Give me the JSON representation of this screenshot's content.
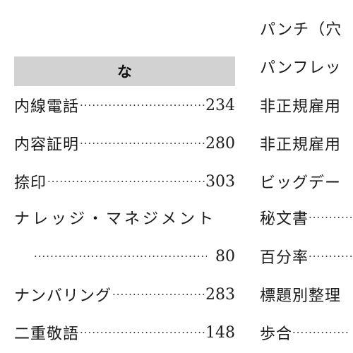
{
  "left_column": {
    "section_header": "な",
    "entries": [
      {
        "term": "内線電話",
        "page": "234"
      },
      {
        "term": "内容証明",
        "page": "280"
      },
      {
        "term": "捺印",
        "page": "303"
      },
      {
        "term": "ナレッジ・マネジメント",
        "page": ""
      },
      {
        "term": "",
        "page": "80"
      },
      {
        "term": "ナンバリング",
        "page": "283"
      },
      {
        "term": "二重敬語",
        "page": "148"
      }
    ]
  },
  "right_column": {
    "entries": [
      {
        "term": "パンチ（穴"
      },
      {
        "term": "パンフレッ"
      },
      {
        "term": "非正規雇用"
      },
      {
        "term": "非正規雇用"
      },
      {
        "term": "ビッグデー"
      },
      {
        "term": "秘文書"
      },
      {
        "term": "百分率"
      },
      {
        "term": "標題別整理"
      },
      {
        "term": "歩合"
      }
    ]
  }
}
